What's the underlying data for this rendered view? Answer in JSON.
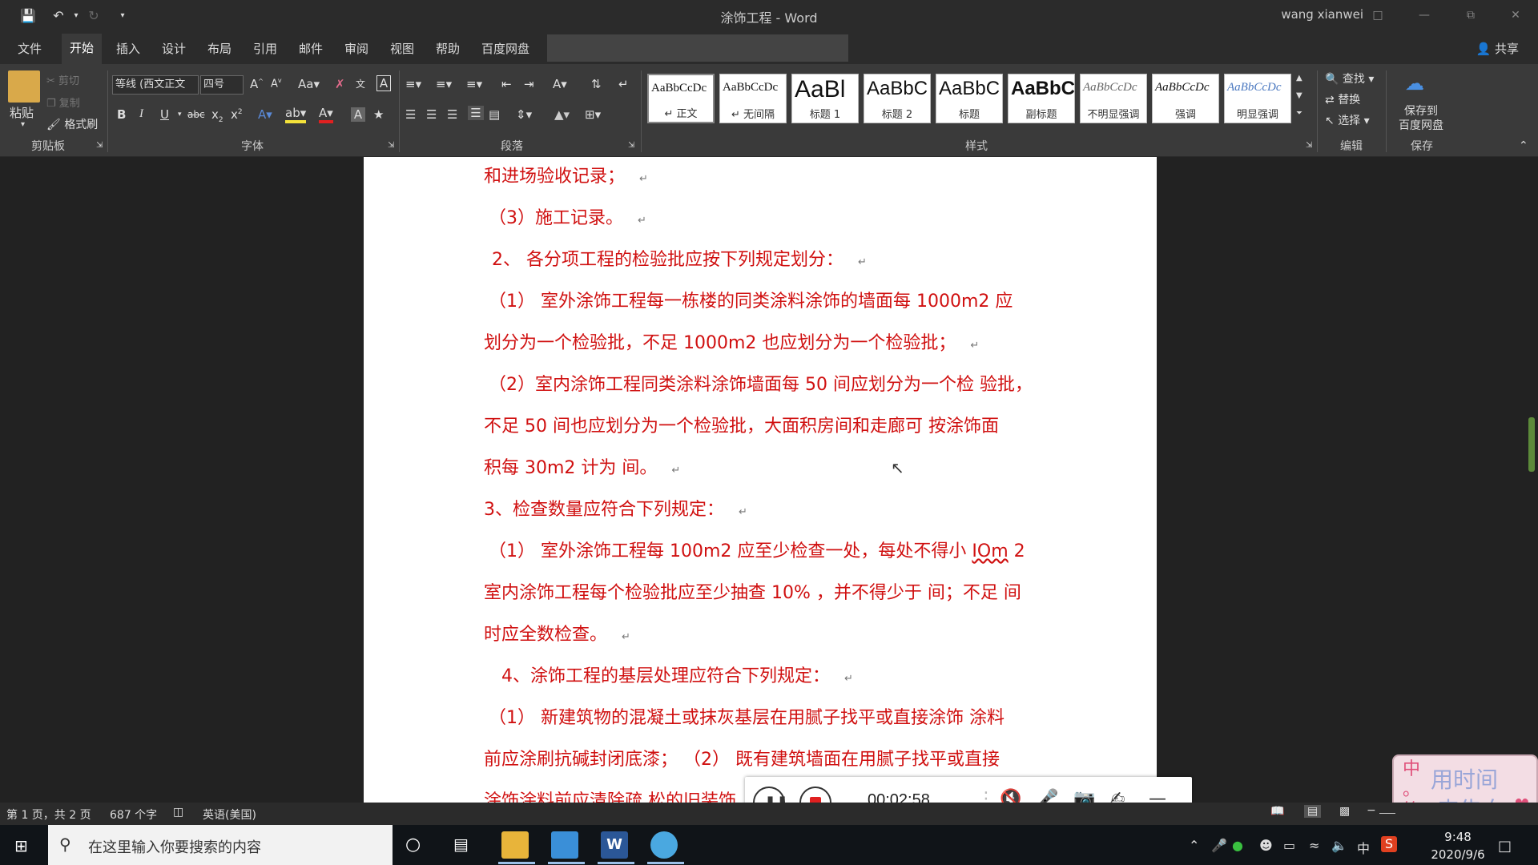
{
  "window": {
    "title": "涂饰工程 - Word",
    "user": "wang xianwei"
  },
  "quick_access": {
    "icons": [
      "save-icon",
      "undo-icon",
      "redo-icon",
      "customize-icon"
    ]
  },
  "menu": {
    "tabs": [
      "文件",
      "开始",
      "插入",
      "设计",
      "布局",
      "引用",
      "邮件",
      "审阅",
      "视图",
      "帮助",
      "百度网盘"
    ],
    "active_index": 1,
    "share_label": "共享"
  },
  "ribbon": {
    "clipboard": {
      "paste": "粘贴",
      "cut": "剪切",
      "copy": "复制",
      "format_painter": "格式刷",
      "group_label": "剪贴板"
    },
    "font": {
      "family": "等线 (西文正文",
      "size": "四号",
      "group_label": "字体"
    },
    "paragraph": {
      "group_label": "段落"
    },
    "styles": {
      "group_label": "样式",
      "items": [
        {
          "preview": "AaBbCcDc",
          "name": "↵ 正文"
        },
        {
          "preview": "AaBbCcDc",
          "name": "↵ 无间隔"
        },
        {
          "preview": "AaBl",
          "name": "标题 1"
        },
        {
          "preview": "AaBbC",
          "name": "标题 2"
        },
        {
          "preview": "AaBbC",
          "name": "标题"
        },
        {
          "preview": "AaBbC",
          "name": "副标题"
        },
        {
          "preview": "AaBbCcDc",
          "name": "不明显强调"
        },
        {
          "preview": "AaBbCcDc",
          "name": "强调"
        },
        {
          "preview": "AaBbCcDc",
          "name": "明显强调"
        }
      ]
    },
    "editing": {
      "find": "查找",
      "replace": "替换",
      "select": "选择",
      "group_label": "编辑"
    },
    "save": {
      "button": "保存到\n百度网盘",
      "btn_line1": "保存到",
      "btn_line2": "百度网盘",
      "group_label": "保存"
    }
  },
  "document": {
    "lines": [
      "和进场验收记录；",
      "（3）施工记录。",
      "2、 各分项工程的检验批应按下列规定划分：",
      "（1）  室外涂饰工程每一栋楼的同类涂料涂饰的墙面每  1000m2  应",
      "划分为一个检验批，不足  1000m2  也应划分为一个检验批；",
      "（2）室内涂饰工程同类涂料涂饰墙面每  50  间应划分为一个检  验批，",
      "不足  50  间也应划分为一个检验批，大面积房间和走廊可  按涂饰面",
      "积每  30m2  计为  间。",
      "3、检查数量应符合下列规定：",
      "（1）  室外涂饰工程每  100m2  应至少检查一处，每处不得小  ",
      "室内涂饰工程每个检验批应至少抽查  10%  ，并不得少于  间；不足  间",
      "时应全数检查。",
      "4、涂饰工程的基层处理应符合下列规定：",
      "（1）  新建筑物的混凝土或抹灰基层在用腻子找平或直接涂饰  涂料",
      "前应涂刷抗碱封闭底漆；    （2）  既有建筑墙面在用腻子找平或直接",
      "涂饰涂料前应清除疏  松的旧装饰"
    ],
    "squiggle_word": "IOm",
    "squiggle_tail": " 2"
  },
  "recorder": {
    "time": "00:02:58"
  },
  "ime_badge": {
    "left_chars": "中\n。\n简",
    "left_top": "中",
    "left_mid": "。",
    "left_bot": "简",
    "line1": "用时间",
    "line2": "来告白"
  },
  "status": {
    "page": "第 1 页，共 2 页",
    "words": "687 个字",
    "language": "英语(美国)"
  },
  "taskbar": {
    "search_placeholder": "在这里输入你要搜索的内容",
    "clock_time": "9:48",
    "clock_date": "2020/9/6",
    "ime": "中"
  },
  "colors": {
    "doc_text": "#d01010",
    "chrome_dark": "#2b2b2b",
    "ribbon": "#3a3a3a"
  }
}
